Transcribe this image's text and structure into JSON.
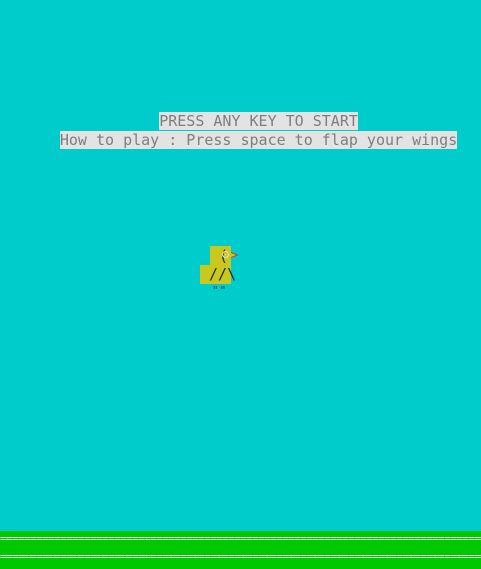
{
  "game": {
    "start_prompt": "PRESS ANY KEY TO START",
    "instructions": "How to play : Press space to flap your wings"
  },
  "bird": {
    "head_glyph": " (",
    "body_glyph": " //\\",
    "feet_glyph": "\"\"",
    "body_color": "#c8c81e",
    "beak_color": "#c04040"
  },
  "ground": {
    "row_1": "====================================================================================",
    "row_2": "====================================================================================",
    "color": "#00c800"
  },
  "colors": {
    "sky": "#00cccc",
    "text": "#7e7e7e",
    "text_background": "#e3e3e3"
  }
}
